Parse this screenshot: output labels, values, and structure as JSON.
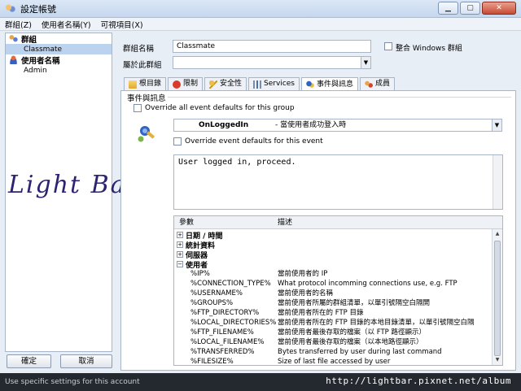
{
  "window": {
    "title": "設定帳號"
  },
  "menu": [
    "群組(Z)",
    "使用者名稱(Y)",
    "可視項目(X)"
  ],
  "tree": {
    "groups_label": "群組",
    "groups": [
      "Classmate"
    ],
    "users_label": "使用者名稱",
    "users": [
      "Admin"
    ]
  },
  "watermark": "Light Bar",
  "buttons": {
    "ok": "確定",
    "cancel": "取消"
  },
  "status": "Use specific settings for this account",
  "url_overlay": "http://lightbar.pixnet.net/album",
  "form": {
    "group_name_label": "群組名稱",
    "group_name_value": "Classmate",
    "windows_group_label": "整合 Windows 群組",
    "parent_group_label": "屬於此群組",
    "parent_group_value": ""
  },
  "tabs": [
    {
      "label": "根目錄",
      "icon": "folder-icon"
    },
    {
      "label": "限制",
      "icon": "limit-icon"
    },
    {
      "label": "安全性",
      "icon": "key-icon"
    },
    {
      "label": "Services",
      "icon": "services-icon"
    },
    {
      "label": "事件與訊息",
      "icon": "events-icon"
    },
    {
      "label": "成員",
      "icon": "members-icon"
    }
  ],
  "events": {
    "section_title": "事件與訊息",
    "override_all_label": "Override all event defaults for this group",
    "event_name": "OnLoggedIn",
    "event_desc": "- 當使用者成功登入時",
    "override_event_label": "Override event defaults for this event",
    "message": "User logged in, proceed."
  },
  "grid": {
    "col_param": "參數",
    "col_desc": "描述",
    "categories": [
      "日期 / 時間",
      "統計資料",
      "伺服器",
      "使用者"
    ],
    "rows": [
      {
        "param": "%IP%",
        "desc": "當前使用者的 IP"
      },
      {
        "param": "%CONNECTION_TYPE%",
        "desc": "What protocol incomming connections use, e.g. FTP"
      },
      {
        "param": "%USERNAME%",
        "desc": "當前使用者的名稱"
      },
      {
        "param": "%GROUPS%",
        "desc": "當前使用者所屬的群組清單，以單引號隔空白隔開"
      },
      {
        "param": "%FTP_DIRECTORY%",
        "desc": "當前使用者所在的 FTP 目錄"
      },
      {
        "param": "%LOCAL_DIRECTORIES%",
        "desc": "當前使用者所在的 FTP 目錄的本地目錄清單，以單引號隔空白隔"
      },
      {
        "param": "%FTP_FILENAME%",
        "desc": "當前使用者最後存取的檔案（以 FTP 路徑顯示）"
      },
      {
        "param": "%LOCAL_FILENAME%",
        "desc": "當前使用者最後存取的檔案（以本地路徑顯示）"
      },
      {
        "param": "%TRANSFERRED%",
        "desc": "Bytes transferred by user during last command"
      },
      {
        "param": "%FILESIZE%",
        "desc": "Size of last file accessed by user"
      }
    ]
  }
}
